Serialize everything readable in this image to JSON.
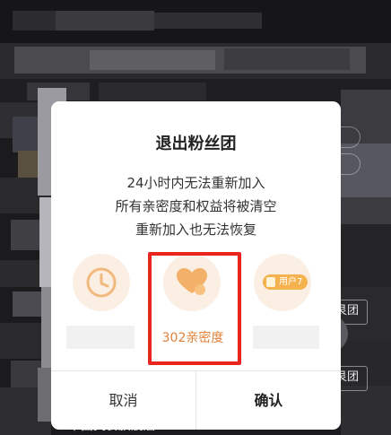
{
  "dialog": {
    "title": "退出粉丝团",
    "lines": [
      "24小时内无法重新加入",
      "所有亲密度和权益将被清空",
      "重新加入也无法恢复"
    ],
    "items": [
      {
        "icon": "clock-icon"
      },
      {
        "icon": "heart-icon",
        "label": "302亲密度"
      },
      {
        "icon": "user-level-badge-icon",
        "badge": "用户7"
      }
    ],
    "cancel_label": "取消",
    "confirm_label": "确认"
  },
  "background": {
    "side_labels": [
      "艮团",
      "艮团"
    ],
    "bottom_text": "中国美食旗舰店"
  },
  "colors": {
    "accent_orange": "#e0823a",
    "highlight_red": "#e8261d",
    "circle_bg": "#fbefe3"
  }
}
